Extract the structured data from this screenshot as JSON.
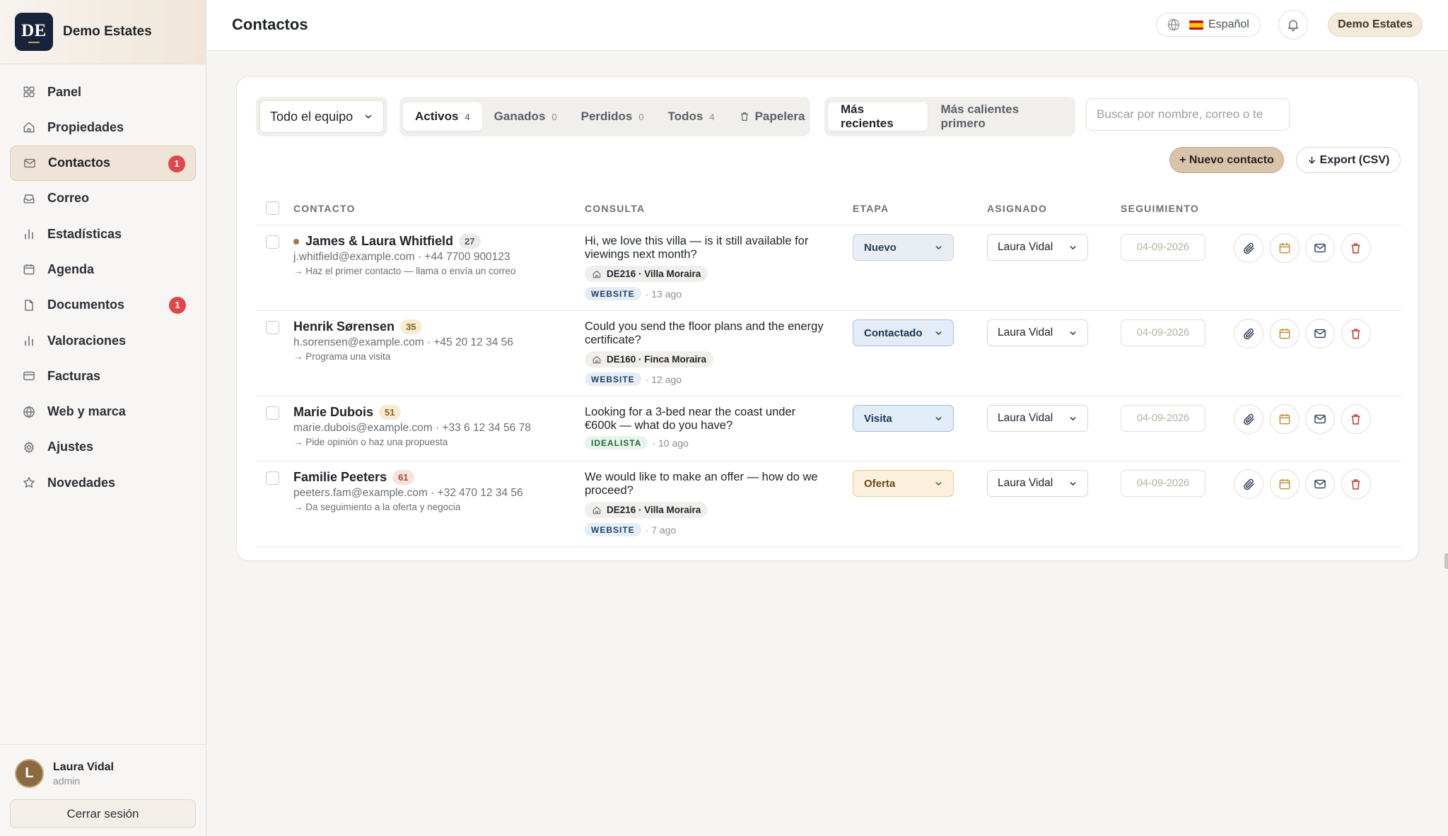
{
  "brand": {
    "logo_text": "DE",
    "name": "Demo Estates"
  },
  "sidebar": {
    "items": [
      {
        "label": "Panel",
        "icon": "grid-icon"
      },
      {
        "label": "Propiedades",
        "icon": "home-icon"
      },
      {
        "label": "Contactos",
        "icon": "mail-icon",
        "badge": "1",
        "active": true
      },
      {
        "label": "Correo",
        "icon": "inbox-icon"
      },
      {
        "label": "Estadísticas",
        "icon": "bar-chart-icon"
      },
      {
        "label": "Agenda",
        "icon": "calendar-icon"
      },
      {
        "label": "Documentos",
        "icon": "document-icon",
        "badge": "1"
      },
      {
        "label": "Valoraciones",
        "icon": "bar-chart-icon"
      },
      {
        "label": "Facturas",
        "icon": "credit-card-icon"
      },
      {
        "label": "Web y marca",
        "icon": "globe-icon"
      },
      {
        "label": "Ajustes",
        "icon": "gear-icon"
      },
      {
        "label": "Novedades",
        "icon": "star-icon"
      }
    ],
    "user": {
      "initial": "L",
      "name": "Laura Vidal",
      "role": "admin"
    },
    "logout_label": "Cerrar sesión"
  },
  "header": {
    "title": "Contactos",
    "language": "Español",
    "org": "Demo Estates"
  },
  "filters": {
    "team": "Todo el equipo",
    "tabs": [
      {
        "label": "Activos",
        "count": "4",
        "active": true
      },
      {
        "label": "Ganados",
        "count": "0"
      },
      {
        "label": "Perdidos",
        "count": "0"
      },
      {
        "label": "Todos",
        "count": "4"
      }
    ],
    "trash_label": "Papelera",
    "sort": [
      {
        "label": "Más recientes",
        "active": true
      },
      {
        "label": "Más calientes primero"
      }
    ],
    "search_placeholder": "Buscar por nombre, correo o te"
  },
  "actions": {
    "new_contact": "+ Nuevo contacto",
    "export": "Export (CSV)"
  },
  "table": {
    "columns": [
      "CONTACTO",
      "CONSULTA",
      "ETAPA",
      "ASIGNADO",
      "SEGUIMIENTO"
    ],
    "rows": [
      {
        "name": "James & Laura Whitfield",
        "score": "27",
        "score_color": "#ecebe8",
        "score_text": "#5b6068",
        "dot": true,
        "contact": "j.whitfield@example.com · +44 7700 900123",
        "hint": "→ Haz el primer contacto — llama o envía un correo",
        "message": "Hi, we love this villa — is it still available for viewings next month?",
        "property": "DE216 · Villa Moraira",
        "source": "WEBSITE",
        "source_type": "website",
        "age": "· 13 ago",
        "stage": "Nuevo",
        "stage_bg": "#e9edf4",
        "stage_border": "#c7d1e0",
        "stage_text": "#2c3e5c",
        "assigned": "Laura Vidal",
        "followup": [
          "04",
          "09",
          "2026"
        ]
      },
      {
        "name": "Henrik Sørensen",
        "score": "35",
        "score_color": "#f7ecd2",
        "score_text": "#8a6420",
        "dot": false,
        "contact": "h.sorensen@example.com · +45 20 12 34 56",
        "hint": "→ Programa una visita",
        "message": "Could you send the floor plans and the energy certificate?",
        "property": "DE160 · Finca Moraira",
        "source": "WEBSITE",
        "source_type": "website",
        "age": "· 12 ago",
        "stage": "Contactado",
        "stage_bg": "#e3ecf7",
        "stage_border": "#a9c0de",
        "stage_text": "#1d3557",
        "assigned": "Laura Vidal",
        "followup": [
          "04",
          "09",
          "2026"
        ]
      },
      {
        "name": "Marie Dubois",
        "score": "51",
        "score_color": "#f7ecd2",
        "score_text": "#8a6420",
        "dot": false,
        "contact": "marie.dubois@example.com · +33 6 12 34 56 78",
        "hint": "→ Pide opinión o haz una propuesta",
        "message": "Looking for a 3-bed near the coast under €600k — what do you have?",
        "property": "",
        "source": "IDEALISTA",
        "source_type": "idealista",
        "age": "· 10 ago",
        "stage": "Visita",
        "stage_bg": "#e3edf8",
        "stage_border": "#9dbbe0",
        "stage_text": "#1d3557",
        "assigned": "Laura Vidal",
        "followup": [
          "04",
          "09",
          "2026"
        ]
      },
      {
        "name": "Familie Peeters",
        "score": "61",
        "score_color": "#f9e3dc",
        "score_text": "#b04a32",
        "dot": false,
        "contact": "peeters.fam@example.com · +32 470 12 34 56",
        "hint": "→ Da seguimiento a la oferta y negocia",
        "message": "We would like to make an offer — how do we proceed?",
        "property": "DE216 · Villa Moraira",
        "source": "WEBSITE",
        "source_type": "website",
        "age": "· 7 ago",
        "stage": "Oferta",
        "stage_bg": "#fbf0dc",
        "stage_border": "#e8c98f",
        "stage_text": "#6b4a12",
        "assigned": "Laura Vidal",
        "followup": [
          "04",
          "09",
          "2026"
        ]
      }
    ],
    "row_actions": [
      {
        "icon": "paperclip-icon",
        "color": "#2c3e5c"
      },
      {
        "icon": "calendar-icon",
        "color": "#c08a2a"
      },
      {
        "icon": "mail-icon",
        "color": "#2c3e5c"
      },
      {
        "icon": "trash-icon",
        "color": "#c0392b"
      }
    ]
  }
}
